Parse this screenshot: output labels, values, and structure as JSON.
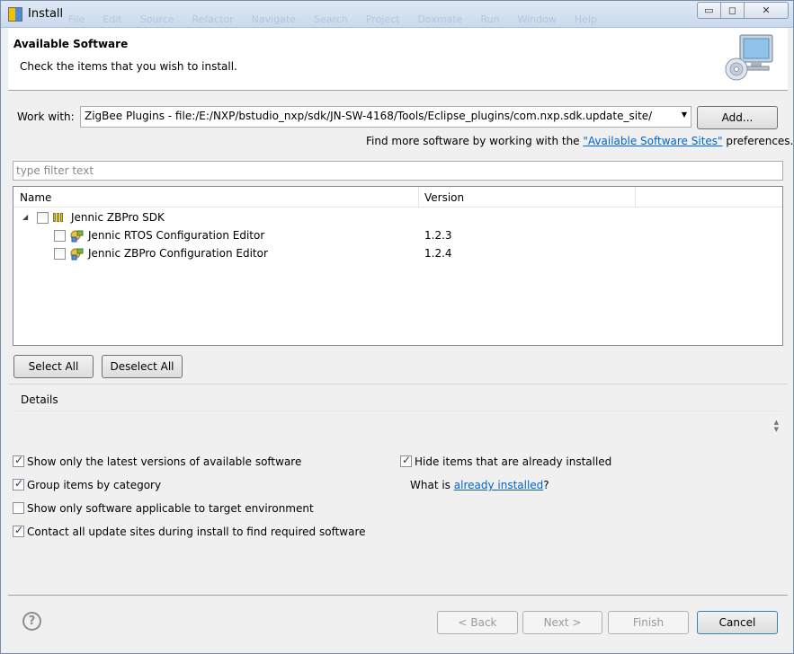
{
  "window": {
    "title": "Install",
    "ghost_menu": [
      "File",
      "Edit",
      "Source",
      "Refactor",
      "Navigate",
      "Search",
      "Project",
      "Doxmate",
      "Run",
      "Window",
      "Help"
    ]
  },
  "header": {
    "title": "Available Software",
    "description": "Check the items that you wish to install."
  },
  "work_with": {
    "label": "Work with:",
    "value": "ZigBee Plugins - file:/E:/NXP/bstudio_nxp/sdk/JN-SW-4168/Tools/Eclipse_plugins/com.nxp.sdk.update_site/",
    "add_label": "Add..."
  },
  "find_more": {
    "prefix": "Find more software by working with the ",
    "link": "\"Available Software Sites\"",
    "suffix": " preferences."
  },
  "filter": {
    "placeholder": "type filter text"
  },
  "tree": {
    "columns": {
      "name": "Name",
      "version": "Version"
    },
    "category": {
      "name": "Jennic ZBPro SDK",
      "checked": false,
      "expanded": true
    },
    "items": [
      {
        "name": "Jennic RTOS Configuration Editor",
        "version": "1.2.3",
        "checked": false
      },
      {
        "name": "Jennic ZBPro Configuration Editor",
        "version": "1.2.4",
        "checked": false
      }
    ]
  },
  "buttons": {
    "select_all": "Select All",
    "deselect_all": "Deselect All",
    "back": "< Back",
    "next": "Next >",
    "finish": "Finish",
    "cancel": "Cancel"
  },
  "details": {
    "label": "Details"
  },
  "options": {
    "latest_versions": {
      "label": "Show only the latest versions of available software",
      "checked": true
    },
    "group_by_category": {
      "label": "Group items by category",
      "checked": true
    },
    "target_env": {
      "label": "Show only software applicable to target environment",
      "checked": false
    },
    "contact_sites": {
      "label": "Contact all update sites during install to find required software",
      "checked": true
    },
    "hide_installed": {
      "label": "Hide items that are already installed",
      "checked": true
    },
    "what_is": {
      "prefix": "What is ",
      "link": "already installed",
      "suffix": "?"
    }
  }
}
